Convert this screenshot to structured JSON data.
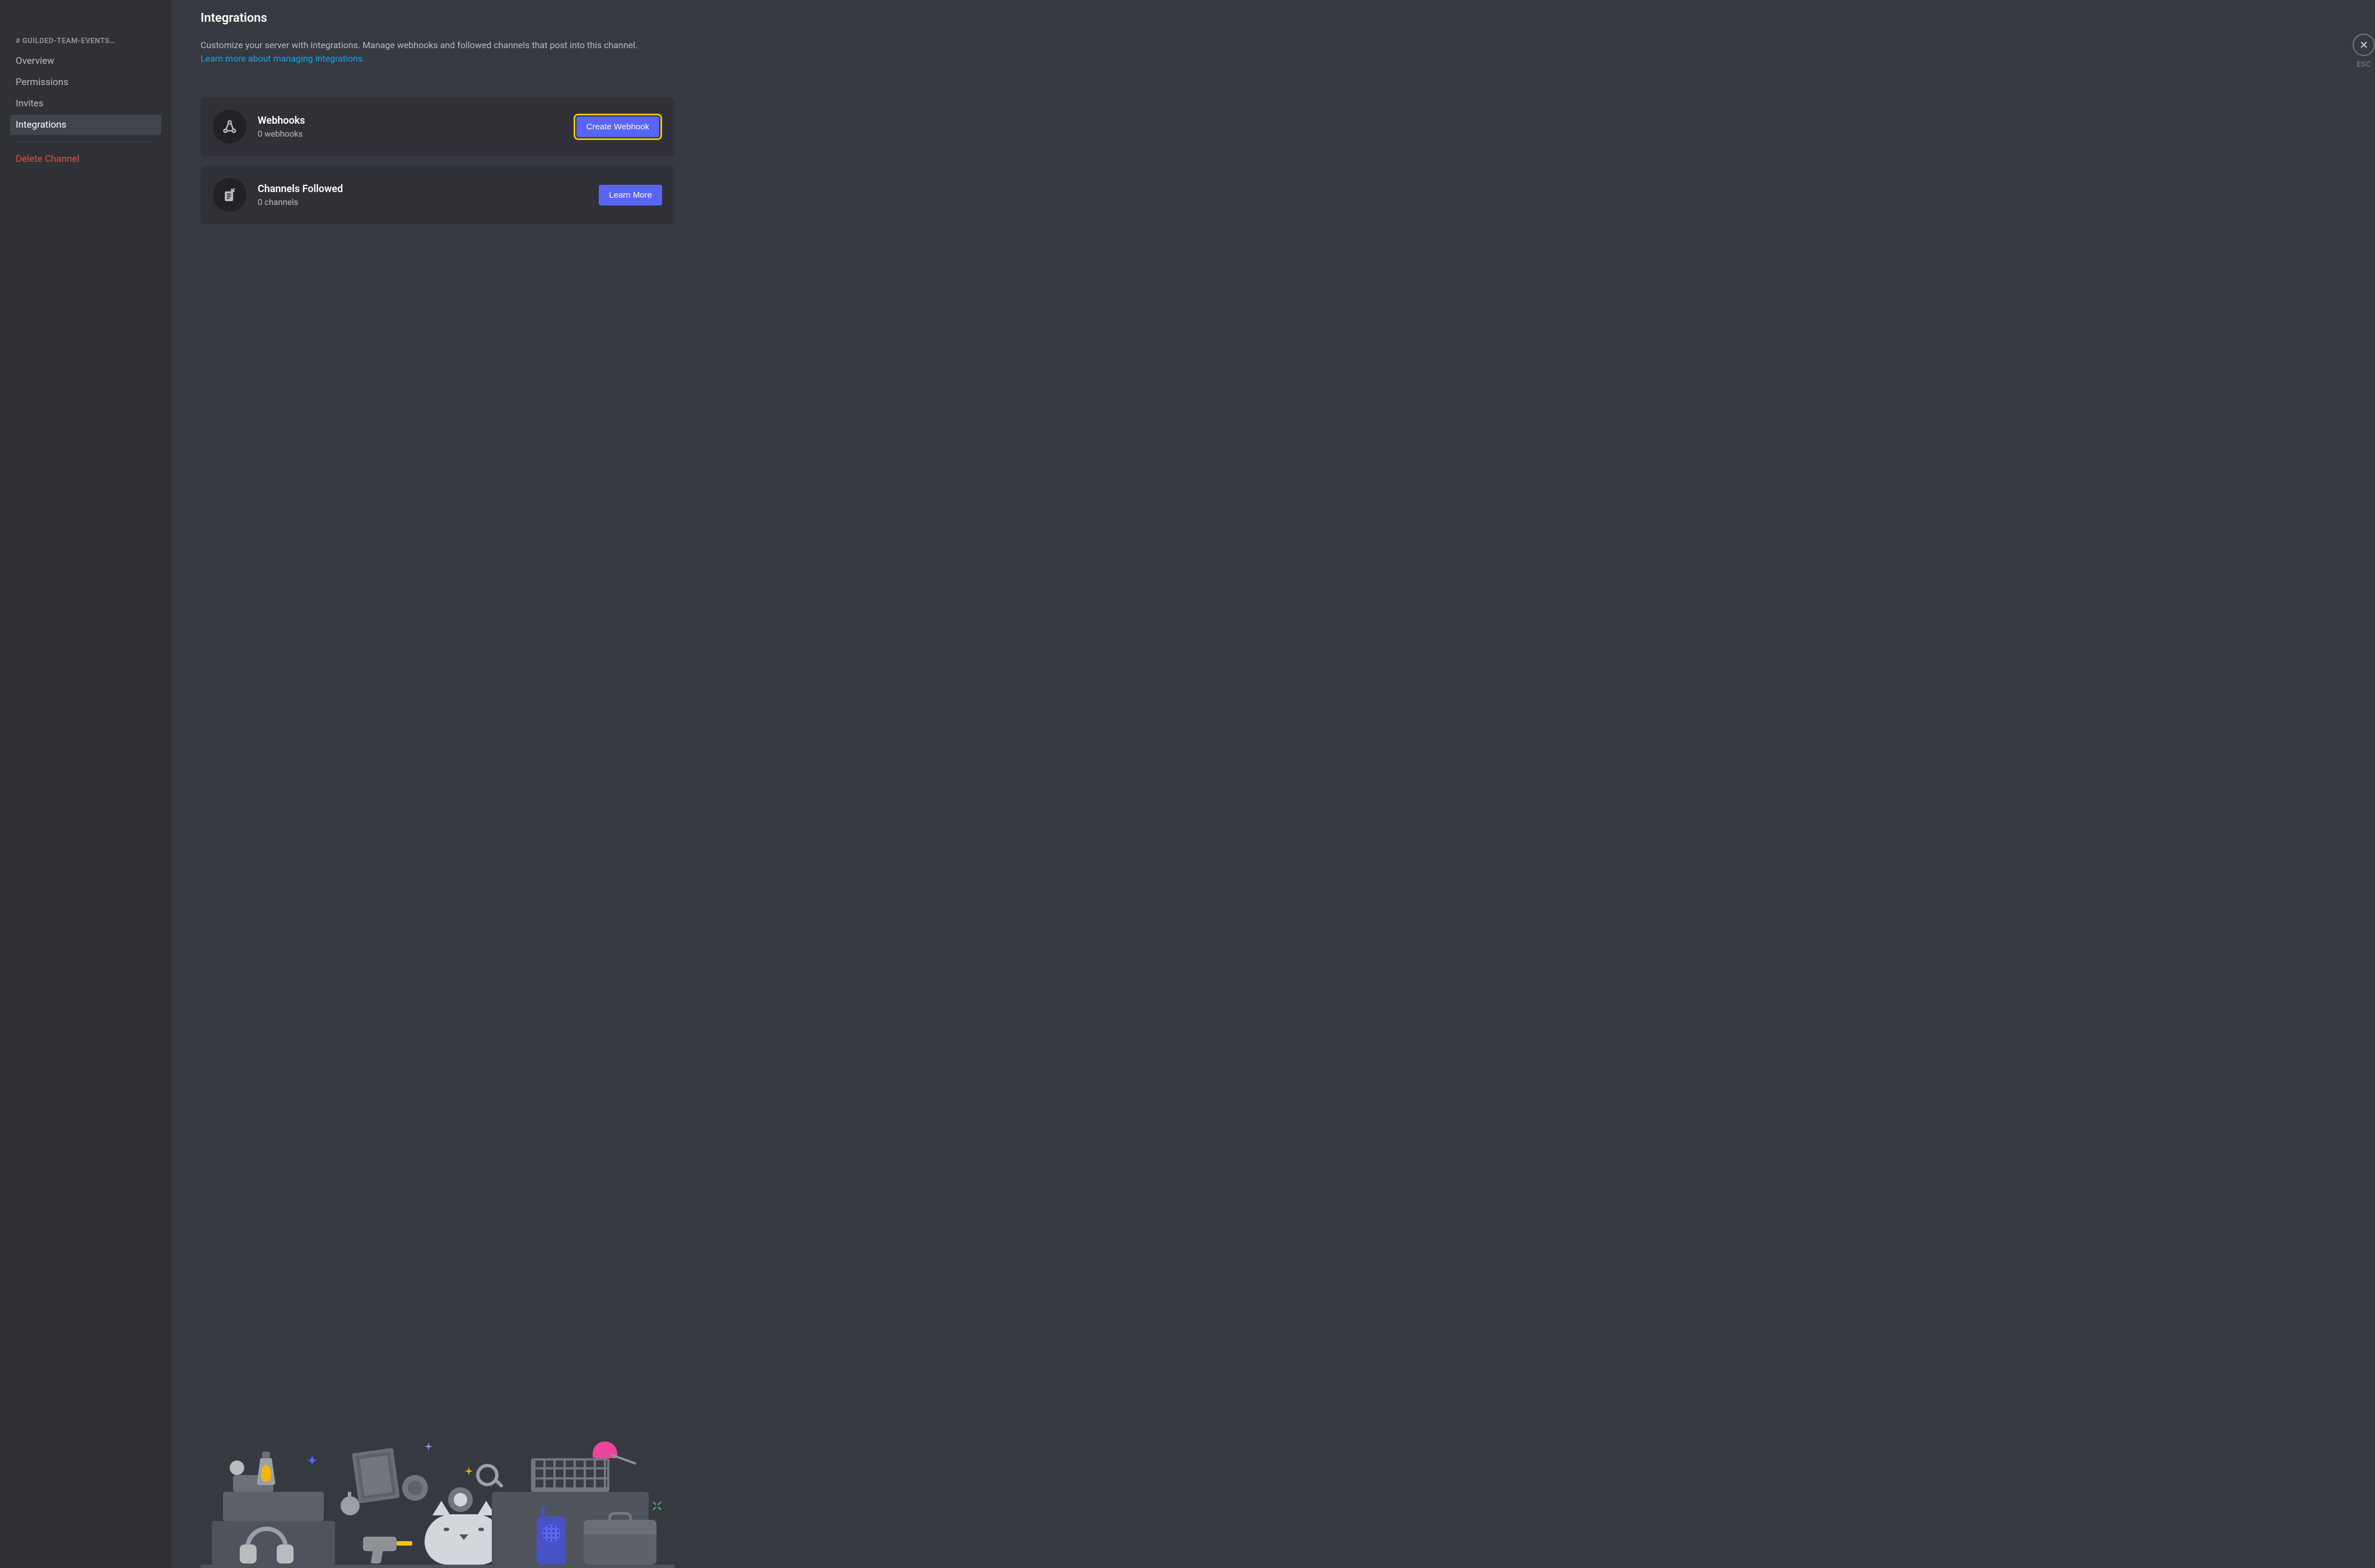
{
  "sidebar": {
    "header": "# GUILDED-TEAM-EVENTS…",
    "items": [
      {
        "label": "Overview",
        "active": false
      },
      {
        "label": "Permissions",
        "active": false
      },
      {
        "label": "Invites",
        "active": false
      },
      {
        "label": "Integrations",
        "active": true
      }
    ],
    "delete_label": "Delete Channel"
  },
  "close": {
    "esc_label": "ESC"
  },
  "page": {
    "title": "Integrations",
    "description": "Customize your server with integrations. Manage webhooks and followed channels that post into this channel.",
    "learn_more_link": "Learn more about managing integrations."
  },
  "cards": {
    "webhooks": {
      "title": "Webhooks",
      "subtitle": "0 webhooks",
      "button": "Create Webhook",
      "highlighted": true
    },
    "channels_followed": {
      "title": "Channels Followed",
      "subtitle": "0 channels",
      "button": "Learn More",
      "highlighted": false
    }
  },
  "colors": {
    "accent": "#5865f2",
    "danger": "#f04747",
    "link": "#00aff4",
    "highlight": "#f1c40f"
  }
}
